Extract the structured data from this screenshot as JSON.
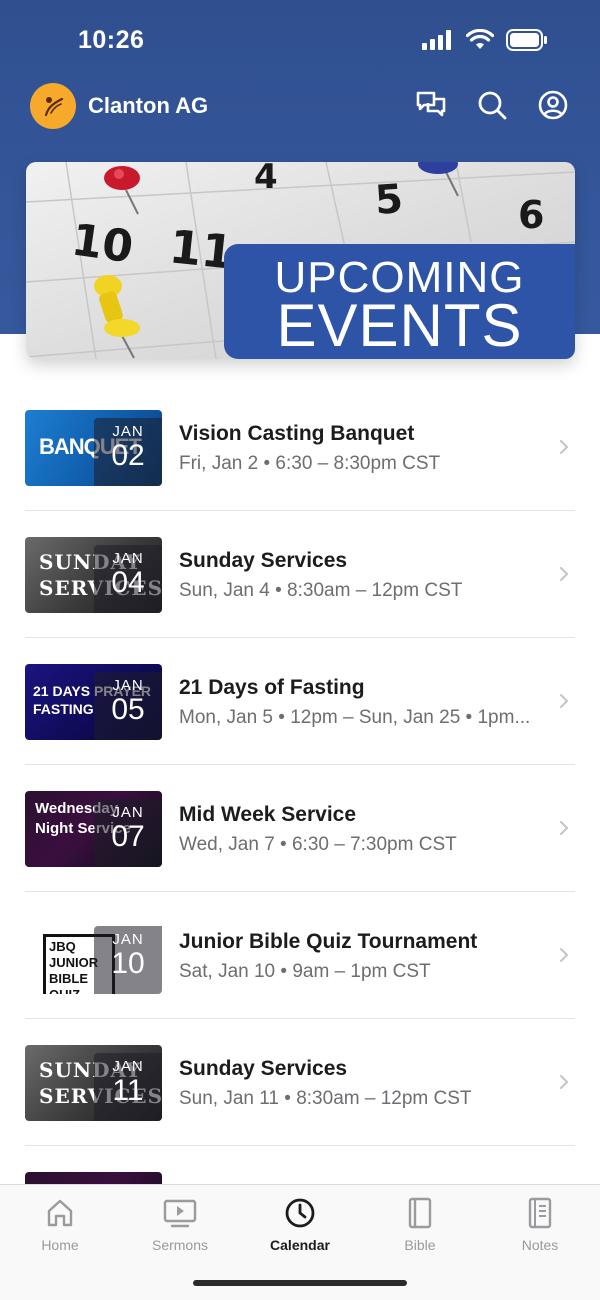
{
  "status": {
    "time": "10:26"
  },
  "header": {
    "org_name": "Clanton AG"
  },
  "banner": {
    "line1": "UPCOMING",
    "line2": "EVENTS",
    "calendar_numbers": [
      "10",
      "11",
      "4",
      "5",
      "6"
    ]
  },
  "events": [
    {
      "title": "Vision Casting Banquet",
      "subtitle": "Fri, Jan 2 • 6:30 – 8:30pm CST",
      "month": "JAN",
      "day": "02",
      "art_text": "BANQUET"
    },
    {
      "title": "Sunday Services",
      "subtitle": "Sun, Jan 4 • 8:30am – 12pm CST",
      "month": "JAN",
      "day": "04",
      "art_text": "SUNDAY SERVICES"
    },
    {
      "title": "21 Days of Fasting",
      "subtitle": "Mon, Jan 5 • 12pm – Sun, Jan 25 • 1pm...",
      "month": "JAN",
      "day": "05",
      "art_text": "21 DAYS PRAYER FASTING"
    },
    {
      "title": "Mid Week Service",
      "subtitle": "Wed, Jan 7 • 6:30 – 7:30pm CST",
      "month": "JAN",
      "day": "07",
      "art_text": "Wednesday Night Service"
    },
    {
      "title": "Junior Bible Quiz Tournament",
      "subtitle": "Sat, Jan 10 • 9am – 1pm CST",
      "month": "JAN",
      "day": "10",
      "art_text": "JBQ JUNIOR BIBLE QUIZ"
    },
    {
      "title": "Sunday Services",
      "subtitle": "Sun, Jan 11 • 8:30am – 12pm CST",
      "month": "JAN",
      "day": "11",
      "art_text": "SUNDAY SERVICES"
    }
  ],
  "tabs": [
    {
      "label": "Home",
      "icon": "home-icon"
    },
    {
      "label": "Sermons",
      "icon": "sermons-icon"
    },
    {
      "label": "Calendar",
      "icon": "clock-icon",
      "active": true
    },
    {
      "label": "Bible",
      "icon": "bible-icon"
    },
    {
      "label": "Notes",
      "icon": "notes-icon"
    }
  ],
  "colors": {
    "header_blue": "#34569a",
    "banner_box": "#2e54a8",
    "avatar_orange": "#f7a92b"
  }
}
